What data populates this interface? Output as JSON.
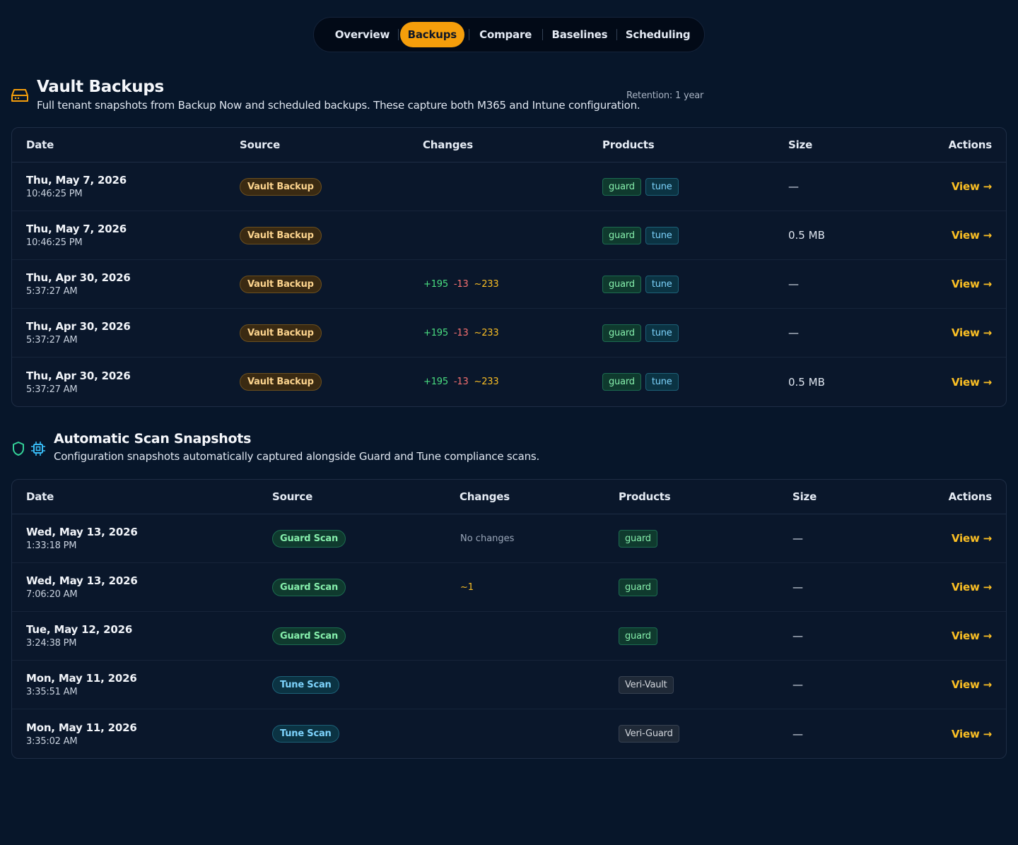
{
  "tabs": [
    "Overview",
    "Backups",
    "Compare",
    "Baselines",
    "Scheduling"
  ],
  "active_tab": "Backups",
  "vault": {
    "title": "Vault Backups",
    "description": "Full tenant snapshots from Backup Now and scheduled backups. These capture both M365 and Intune configuration.",
    "retention": "Retention: 1 year",
    "headers": {
      "date": "Date",
      "source": "Source",
      "changes": "Changes",
      "products": "Products",
      "size": "Size",
      "actions": "Actions"
    },
    "rows": [
      {
        "date": "Thu, May 7, 2026",
        "time": "10:46:25 PM",
        "source": "Vault Backup",
        "added": "",
        "removed": "",
        "modified": "",
        "p1": "guard",
        "p2": "tune",
        "size": "—",
        "action": "View →"
      },
      {
        "date": "Thu, May 7, 2026",
        "time": "10:46:25 PM",
        "source": "Vault Backup",
        "added": "",
        "removed": "",
        "modified": "",
        "p1": "guard",
        "p2": "tune",
        "size": "0.5 MB",
        "action": "View →"
      },
      {
        "date": "Thu, Apr 30, 2026",
        "time": "5:37:27 AM",
        "source": "Vault Backup",
        "added": "+195",
        "removed": "-13",
        "modified": "~233",
        "p1": "guard",
        "p2": "tune",
        "size": "—",
        "action": "View →"
      },
      {
        "date": "Thu, Apr 30, 2026",
        "time": "5:37:27 AM",
        "source": "Vault Backup",
        "added": "+195",
        "removed": "-13",
        "modified": "~233",
        "p1": "guard",
        "p2": "tune",
        "size": "—",
        "action": "View →"
      },
      {
        "date": "Thu, Apr 30, 2026",
        "time": "5:37:27 AM",
        "source": "Vault Backup",
        "added": "+195",
        "removed": "-13",
        "modified": "~233",
        "p1": "guard",
        "p2": "tune",
        "size": "0.5 MB",
        "action": "View →"
      }
    ]
  },
  "scans": {
    "title": "Automatic Scan Snapshots",
    "description": "Configuration snapshots automatically captured alongside Guard and Tune compliance scans.",
    "headers": {
      "date": "Date",
      "source": "Source",
      "changes": "Changes",
      "products": "Products",
      "size": "Size",
      "actions": "Actions"
    },
    "rows": [
      {
        "date": "Wed, May 13, 2026",
        "time": "1:33:18 PM",
        "source": "Guard Scan",
        "changes": "No changes",
        "product": "guard",
        "size": "—",
        "action": "View →"
      },
      {
        "date": "Wed, May 13, 2026",
        "time": "7:06:20 AM",
        "source": "Guard Scan",
        "changes": "~1",
        "product": "guard",
        "size": "—",
        "action": "View →"
      },
      {
        "date": "Tue, May 12, 2026",
        "time": "3:24:38 PM",
        "source": "Guard Scan",
        "changes": "",
        "product": "guard",
        "size": "—",
        "action": "View →"
      },
      {
        "date": "Mon, May 11, 2026",
        "time": "3:35:51 AM",
        "source": "Tune Scan",
        "changes": "",
        "product": "Veri-Vault",
        "size": "—",
        "action": "View →"
      },
      {
        "date": "Mon, May 11, 2026",
        "time": "3:35:02 AM",
        "source": "Tune Scan",
        "changes": "",
        "product": "Veri-Guard",
        "size": "—",
        "action": "View →"
      }
    ]
  }
}
